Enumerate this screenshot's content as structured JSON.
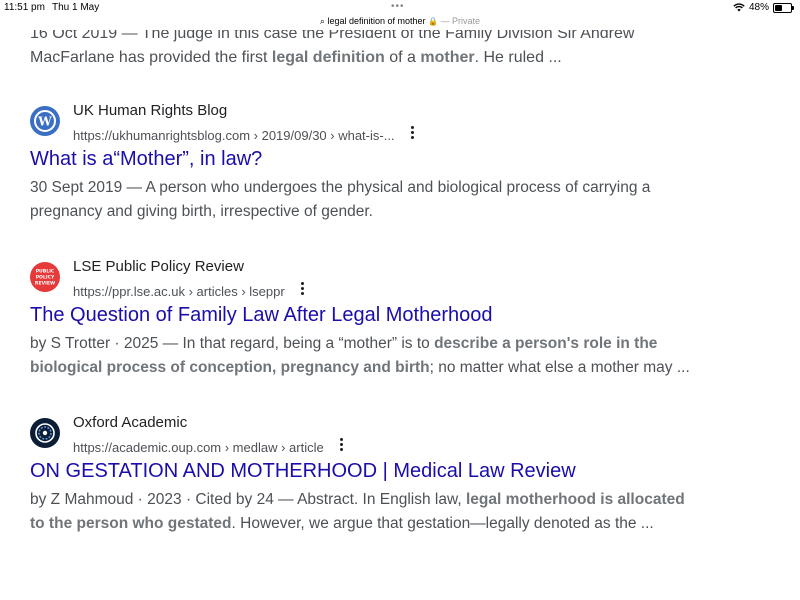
{
  "status": {
    "time": "11:51 pm",
    "date": "Thu 1 May",
    "url_text": "legal definition of mother",
    "private_label": "— Private",
    "battery": "48%",
    "battery_level": 0.48
  },
  "partial_snippet": {
    "line1": "16 Oct 2019 — The judge in this case the President of the Family Division Sir Andrew",
    "line2_pre": "MacFarlane has provided the first ",
    "line2_b1": "legal definition",
    "line2_mid": " of a ",
    "line2_b2": "mother",
    "line2_post": ". He ruled ..."
  },
  "results": [
    {
      "source": "UK Human Rights Blog",
      "url": "https://ukhumanrightsblog.com › 2019/09/30 › what-is-...",
      "title": "What is a“Mother”, in law?",
      "snippet_line1": "30 Sept 2019 — A person who undergoes the physical and biological process of carrying a",
      "snippet_line2": "pregnancy and giving birth, irrespective of gender.",
      "favicon": "wordpress-icon"
    },
    {
      "source": "LSE Public Policy Review",
      "url": "https://ppr.lse.ac.uk › articles › lseppr",
      "title": "The Question of Family Law After Legal Motherhood",
      "snippet_pre": "by S Trotter · 2025 — In that regard, being a “mother” is to ",
      "snippet_b1": "describe a person's role in the",
      "snippet_b2": "biological process of conception, pregnancy and birth",
      "snippet_post": "; no matter what else a mother may ...",
      "favicon": "lse-ppr-icon",
      "favicon_text": [
        "PUBLIC",
        "POLICY",
        "REVIEW"
      ]
    },
    {
      "source": "Oxford Academic",
      "url": "https://academic.oup.com › medlaw › article",
      "title": "ON GESTATION AND MOTHERHOOD | Medical Law Review",
      "snippet_pre": "by Z Mahmoud · 2023 · Cited by 24 — Abstract. In English law, ",
      "snippet_b1": "legal motherhood is allocated",
      "snippet_b2": "to the person who gestated",
      "snippet_post": ". However, we argue that gestation—legally denoted as the ...",
      "favicon": "oxford-academic-icon"
    }
  ],
  "colors": {
    "link": "#1a0dab",
    "text": "#4d5156",
    "bold": "#70757a"
  }
}
